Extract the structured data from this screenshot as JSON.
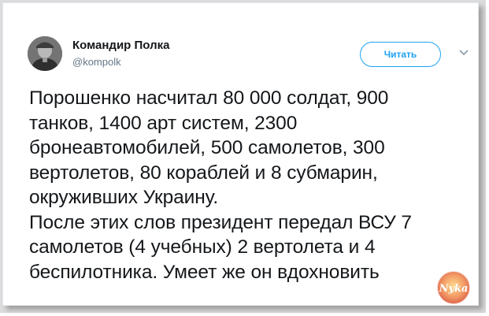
{
  "author": {
    "display_name": "Командир Полка",
    "handle": "@kompolk",
    "avatar_icon": "profile-photo"
  },
  "follow_button": {
    "label": "Читать"
  },
  "tweet": {
    "text": "Порошенко насчитал 80 000 солдат, 900\nтанков, 1400 арт систем, 2300\nбронеавтомобилей, 500 самолетов, 300\nвертолетов, 80 кораблей и 8 субмарин,\nокруживших Украину.\nПосле этих слов президент передал ВСУ 7\nсамолетов (4 учебных) 2 вертолета и 4\nбеспилотника. Умеет же он вдохновить"
  },
  "watermark": {
    "text": "Nyka"
  },
  "colors": {
    "accent": "#1da1f2",
    "text_primary": "#14171a",
    "text_secondary": "#657786",
    "watermark": "#e8603c"
  }
}
